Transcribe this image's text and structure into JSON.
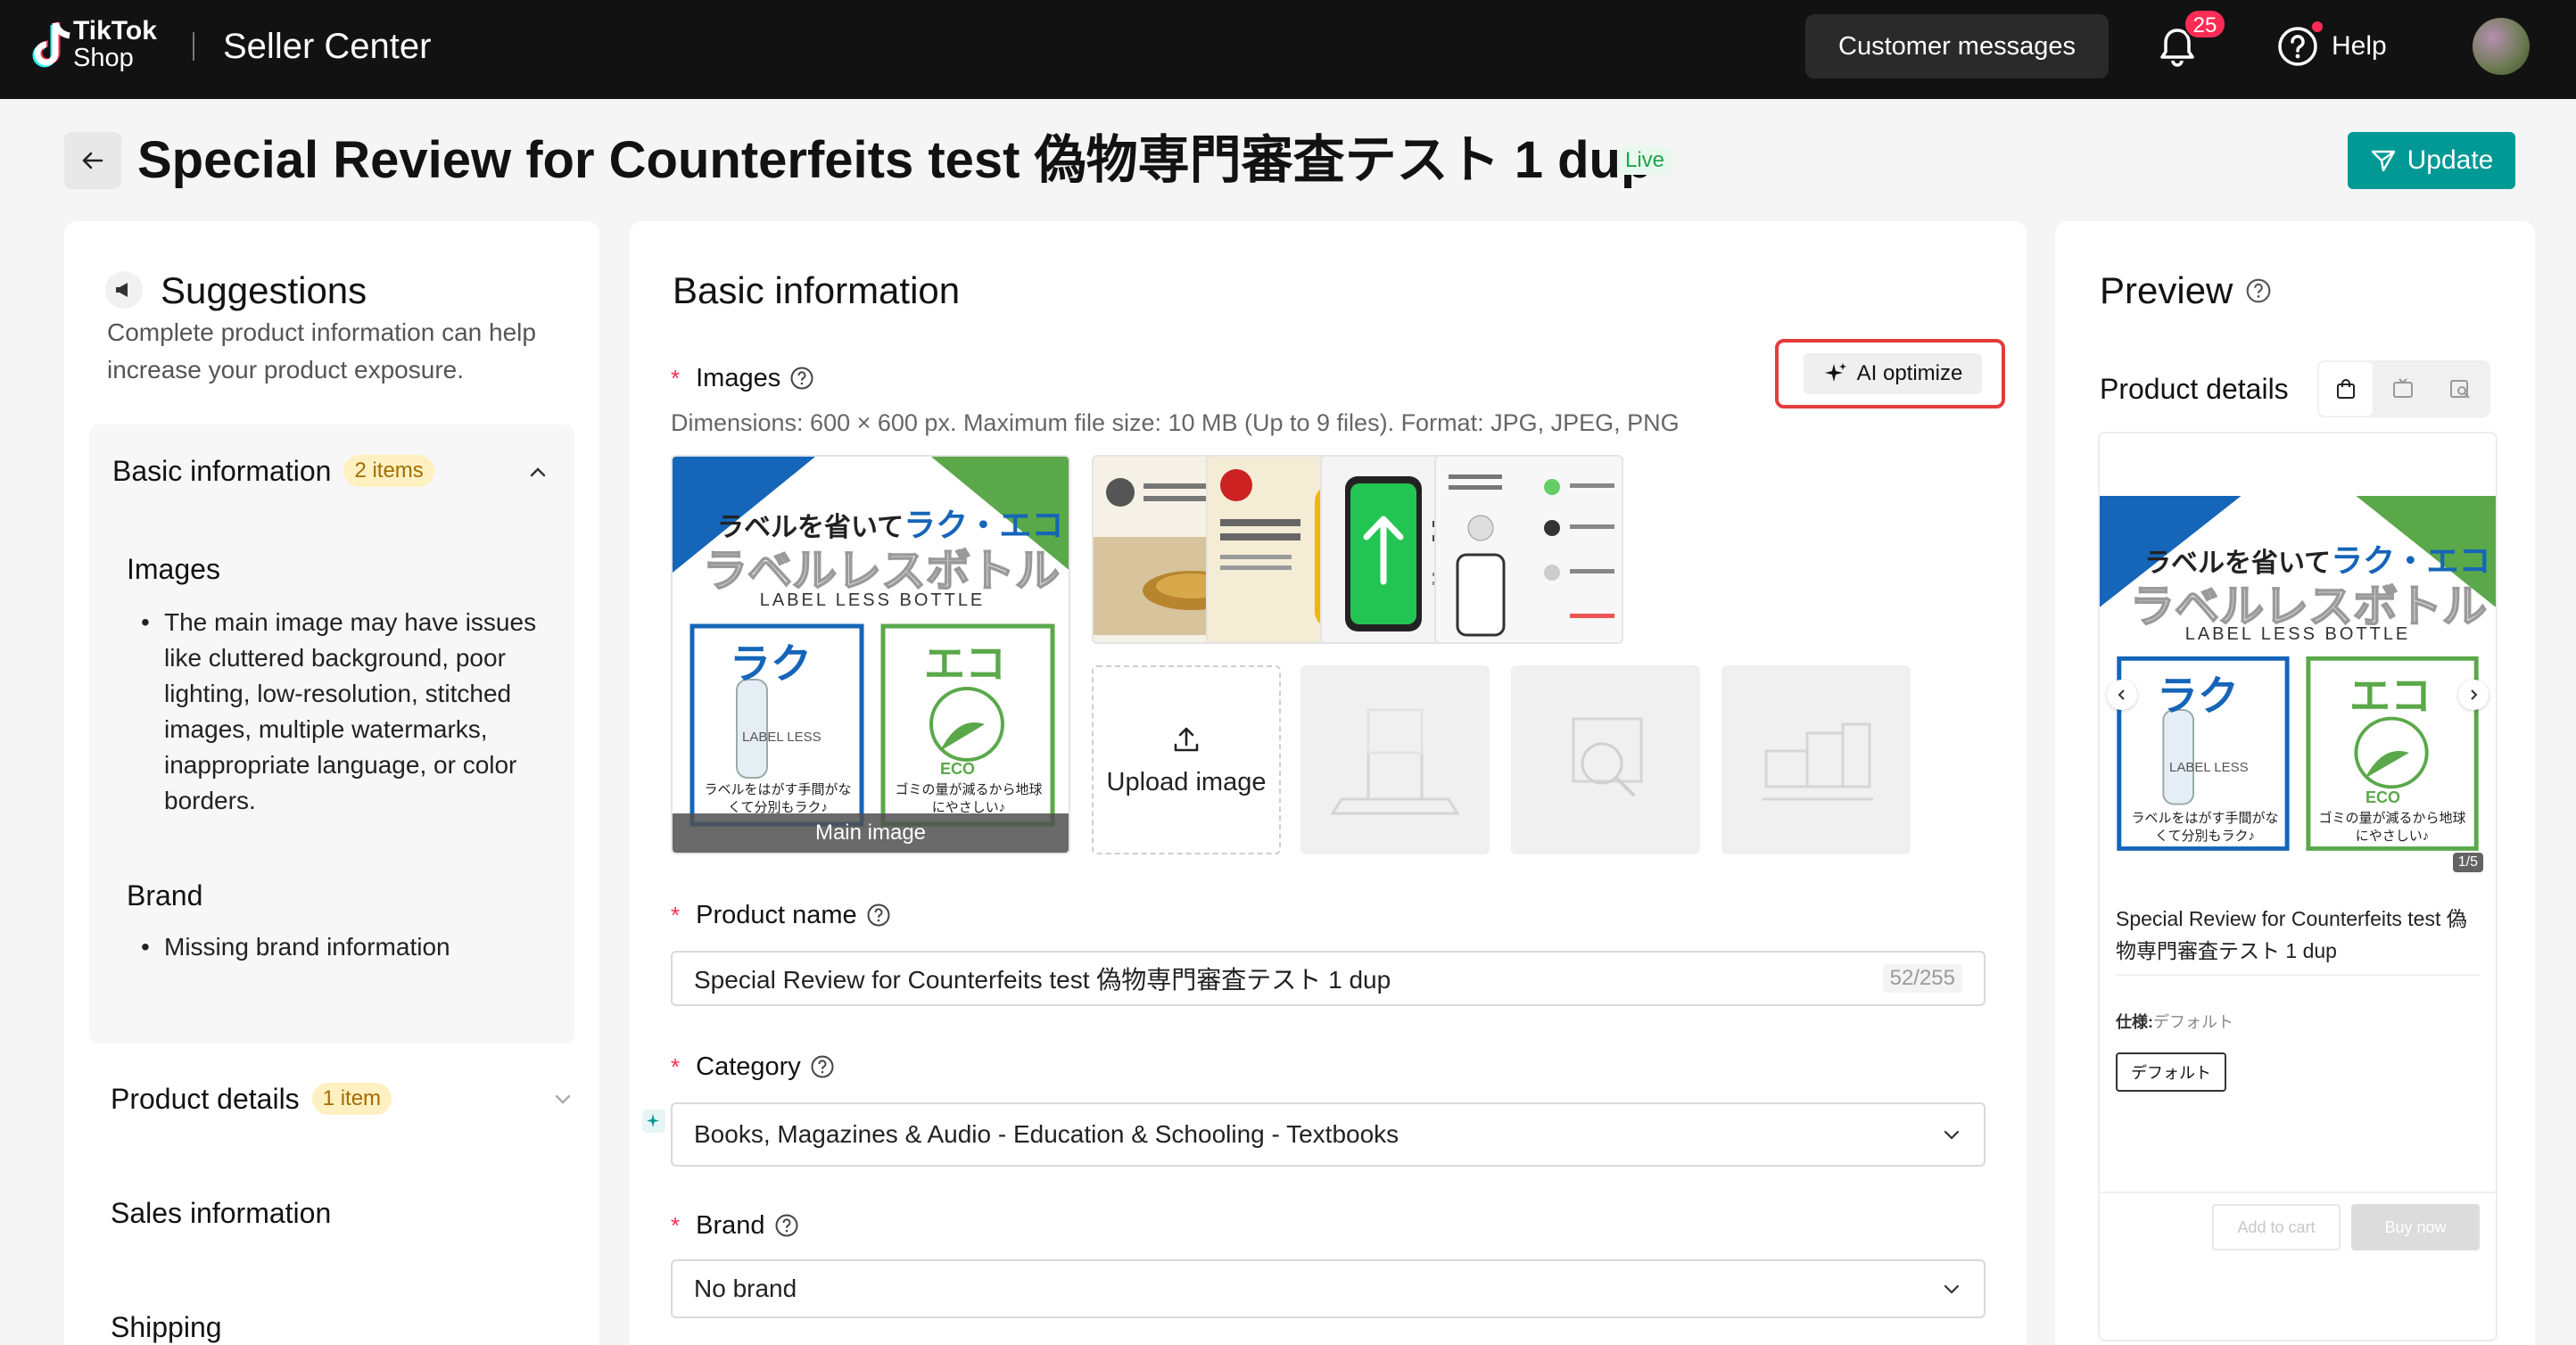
{
  "topbar": {
    "logo_line1": "TikTok",
    "logo_line2": "Shop",
    "app_title": "Seller Center",
    "customer_messages": "Customer messages",
    "notification_count": "25",
    "help": "Help"
  },
  "header": {
    "title": "Special Review for Counterfeits test 偽物専門審査テスト 1 dup",
    "status": "Live",
    "update_label": "Update"
  },
  "suggestions": {
    "title": "Suggestions",
    "description": "Complete product information can help increase your product exposure.",
    "sections": [
      {
        "label": "Basic information",
        "count": "2 items",
        "expanded": true
      },
      {
        "label": "Product details",
        "count": "1 item",
        "expanded": false
      },
      {
        "label": "Sales information"
      },
      {
        "label": "Shipping"
      }
    ],
    "images_heading": "Images",
    "images_tip": "The main image may have issues like cluttered background, poor lighting, low-resolution, stitched images, multiple watermarks, inappropriate language, or color borders.",
    "brand_heading": "Brand",
    "brand_tip": "Missing brand information"
  },
  "basic_info": {
    "title": "Basic information",
    "images_label": "Images",
    "ai_optimize": "AI optimize",
    "images_hint": "Dimensions: 600 × 600 px. Maximum file size: 10 MB (Up to 9 files). Format: JPG, JPEG, PNG",
    "main_image_label": "Main image",
    "upload_label": "Upload image",
    "main_image_text": {
      "headline_a": "ラベルを省いて",
      "headline_b": "ラク・エコ",
      "headline_c": "ラベルレスボトル",
      "en": "LABEL LESS BOTTLE",
      "raku": "ラク",
      "eco": "エコ",
      "label_less": "LABEL LESS",
      "raku_note": "ラベルをはがす手間がなくて分別もラク♪",
      "eco_note": "ゴミの量が減るから地球にやさしい♪",
      "eco_tag": "ECO"
    },
    "product_name_label": "Product name",
    "product_name_value": "Special Review for Counterfeits test 偽物専門審査テスト 1 dup",
    "product_name_counter": "52/255",
    "category_label": "Category",
    "category_value": "Books, Magazines & Audio - Education & Schooling - Textbooks",
    "brand_label": "Brand",
    "brand_value": "No brand"
  },
  "preview": {
    "title": "Preview",
    "subtitle": "Product details",
    "page_indicator": "1/5",
    "product_name": "Special Review for Counterfeits test 偽物専門審査テスト 1 dup",
    "spec_label": "仕様:",
    "spec_value": "デフォルト",
    "chip": "デフォルト",
    "add_to_cart": "Add to cart",
    "buy_now": "Buy now"
  },
  "colors": {
    "accent": "#009995",
    "badge": "#fe2c55",
    "highlight_border": "#e53b3b",
    "image_blue": "#1565b8",
    "image_green": "#5aa84a"
  }
}
